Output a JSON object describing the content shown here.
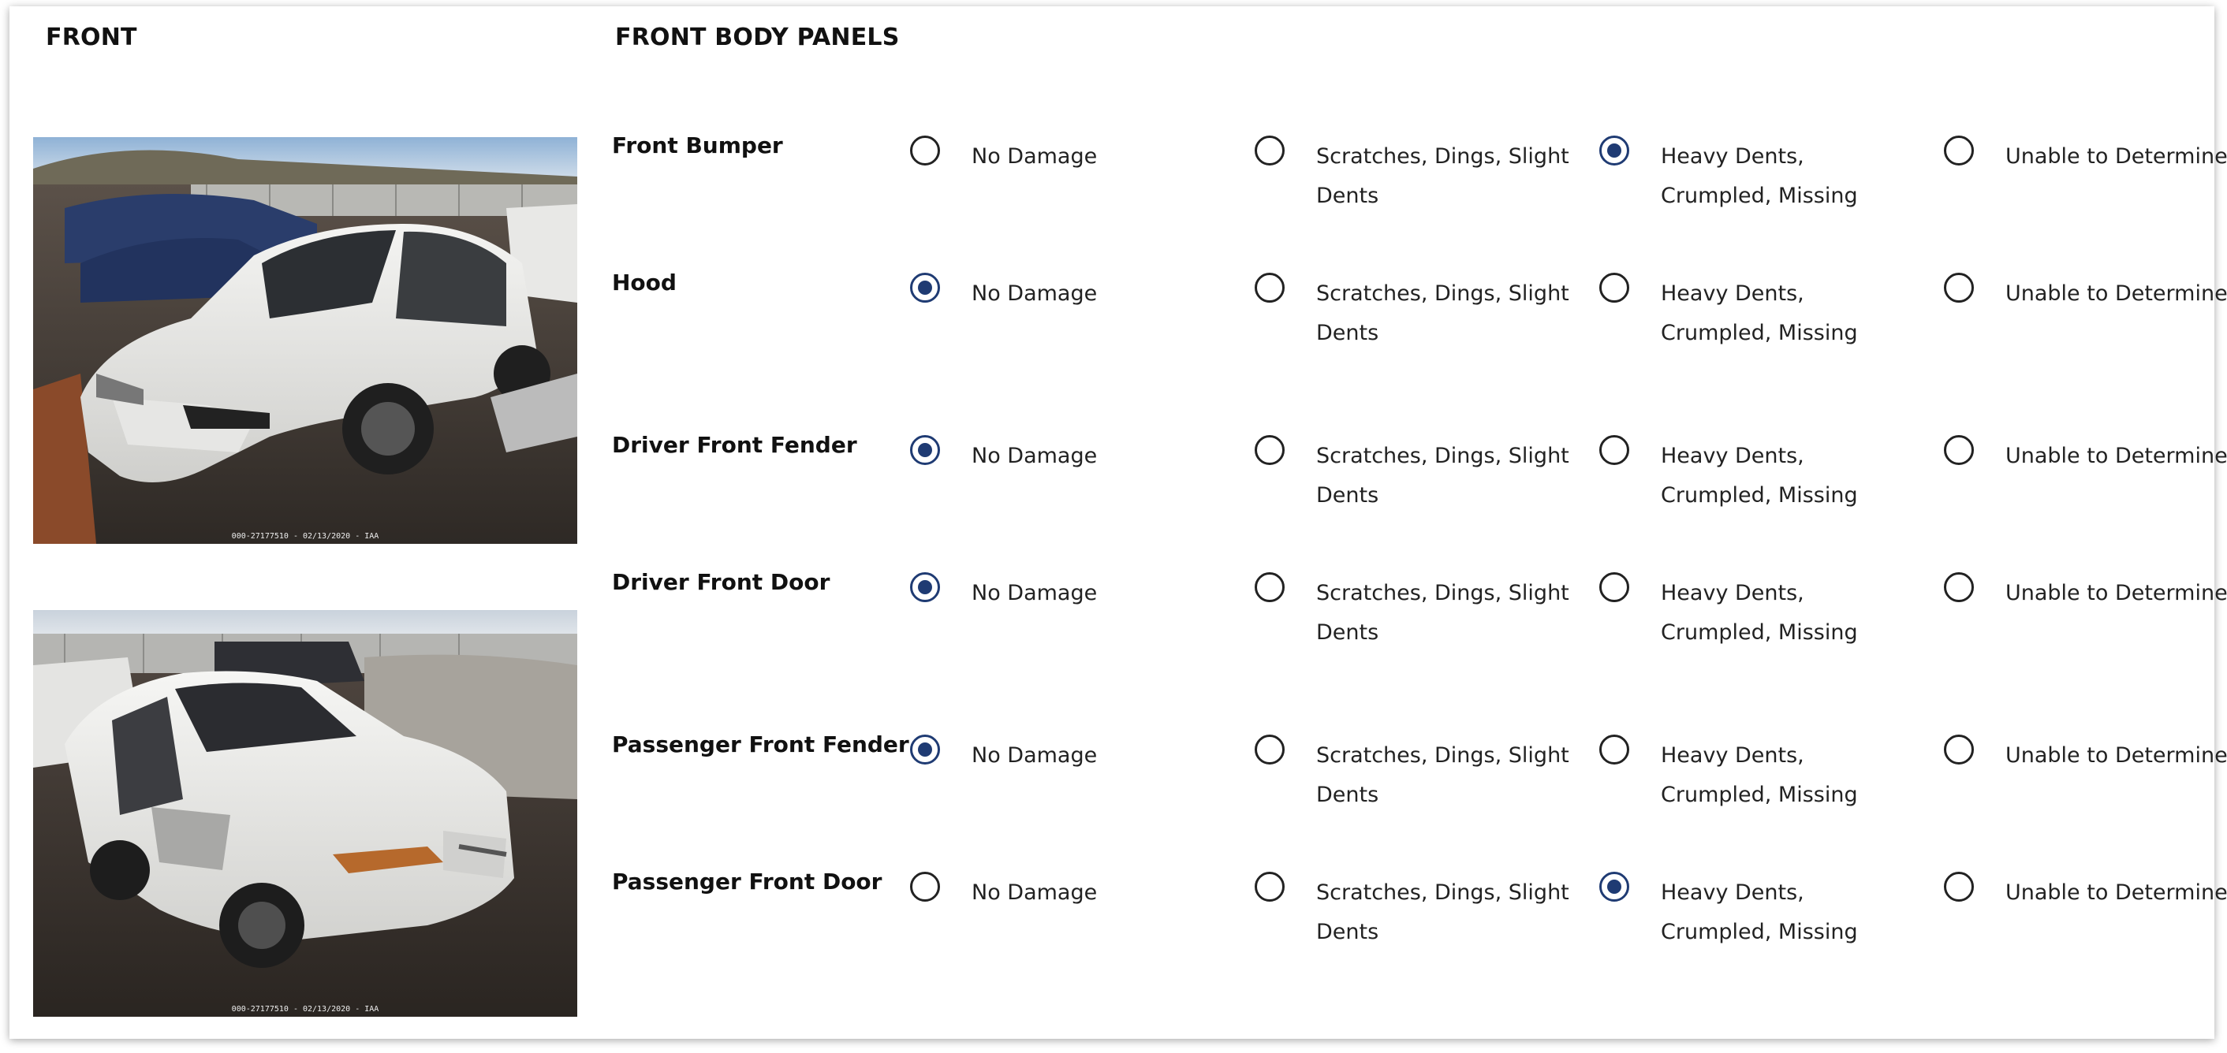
{
  "left_section": {
    "title": "FRONT"
  },
  "right_section": {
    "title": "FRONT BODY PANELS"
  },
  "photos": [
    {
      "caption": "000-27177510 - 02/13/2020 - IAA"
    },
    {
      "caption": "000-27177510 - 02/13/2020 - IAA"
    }
  ],
  "options": [
    "No Damage",
    "Scratches, Dings, Slight Dents",
    "Heavy Dents, Crumpled, Missing",
    "Unable to Determine"
  ],
  "panels": [
    {
      "label": "Front Bumper",
      "selected": "Heavy Dents, Crumpled, Missing"
    },
    {
      "label": "Hood",
      "selected": "No Damage"
    },
    {
      "label": "Driver Front Fender",
      "selected": "No Damage"
    },
    {
      "label": "Driver Front Door",
      "selected": "No Damage"
    },
    {
      "label": "Passenger Front Fender",
      "selected": "No Damage"
    },
    {
      "label": "Passenger Front Door",
      "selected": "Heavy Dents, Crumpled, Missing"
    }
  ],
  "colors": {
    "accent": "#1f3b73",
    "radio_border": "#222222",
    "text": "#111111"
  }
}
